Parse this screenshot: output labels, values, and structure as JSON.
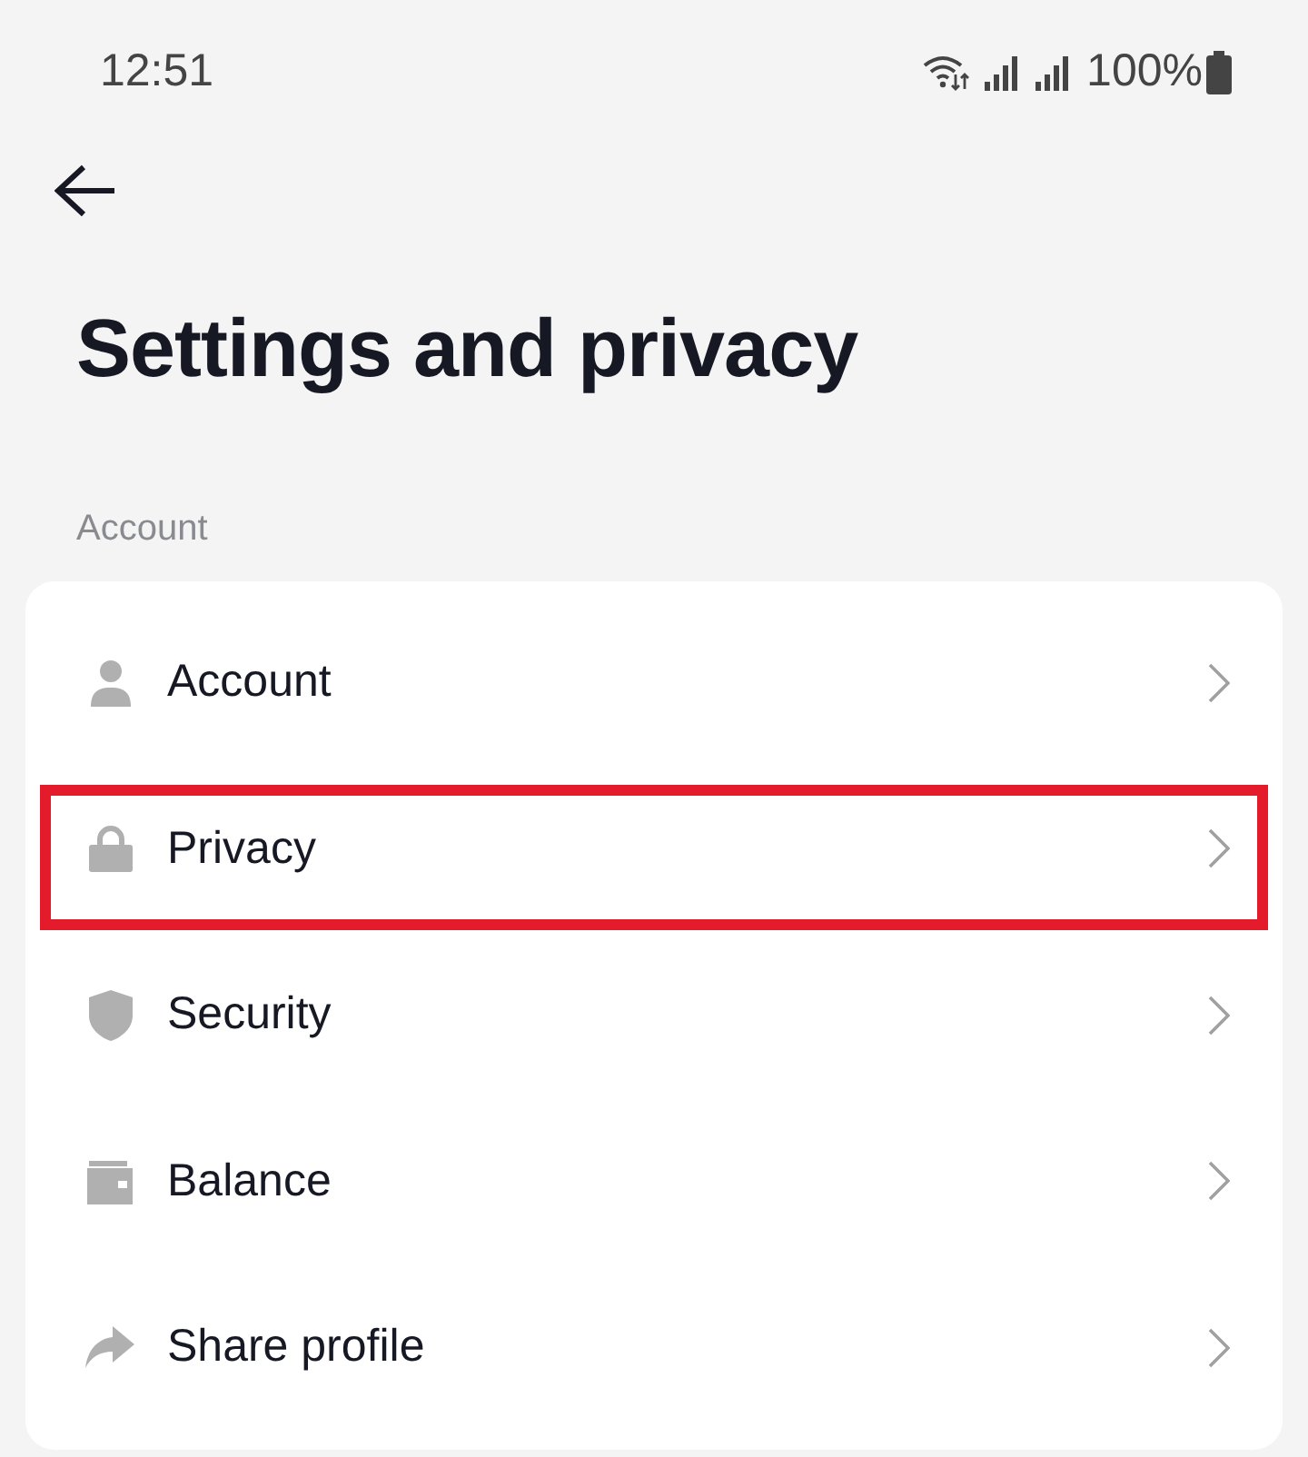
{
  "status_bar": {
    "time": "12:51",
    "battery": "100%"
  },
  "header": {
    "title": "Settings and privacy"
  },
  "sections": [
    {
      "label": "Account",
      "items": [
        {
          "label": "Account",
          "highlighted": false
        },
        {
          "label": "Privacy",
          "highlighted": true
        },
        {
          "label": "Security",
          "highlighted": false
        },
        {
          "label": "Balance",
          "highlighted": false
        },
        {
          "label": "Share profile",
          "highlighted": false
        }
      ]
    }
  ]
}
